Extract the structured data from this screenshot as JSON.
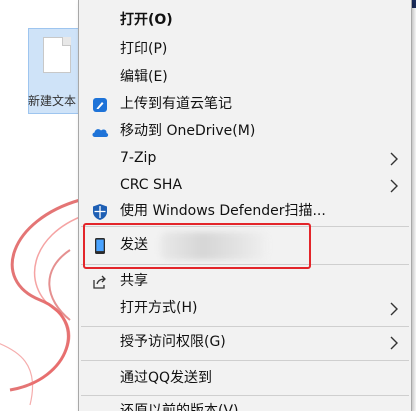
{
  "desktop": {
    "icon_label": "新建文本"
  },
  "menu": {
    "items": [
      {
        "label": "打开(O)",
        "bold": true
      },
      {
        "label": "打印(P)"
      },
      {
        "label": "编辑(E)"
      },
      {
        "label": "上传到有道云笔记",
        "icon": "youdao-note-icon"
      },
      {
        "label": "移动到 OneDrive(M)",
        "icon": "onedrive-cloud-icon"
      },
      {
        "label": "7-Zip",
        "submenu": true
      },
      {
        "label": "CRC SHA",
        "submenu": true
      },
      {
        "label": "使用 Windows Defender扫描...",
        "icon": "windows-defender-shield-icon"
      },
      {
        "label": "发送",
        "icon": "phone-icon"
      },
      {
        "label": "共享",
        "icon": "share-icon"
      },
      {
        "label": "打开方式(H)",
        "submenu": true
      },
      {
        "label": "授予访问权限(G)",
        "submenu": true
      },
      {
        "label": "通过QQ发送到"
      },
      {
        "label": "还原以前的版本(V)"
      }
    ]
  },
  "colors": {
    "highlight_border": "#e3252a",
    "accent_blue": "#1e73d8",
    "menu_bg": "#f2f2f2"
  }
}
